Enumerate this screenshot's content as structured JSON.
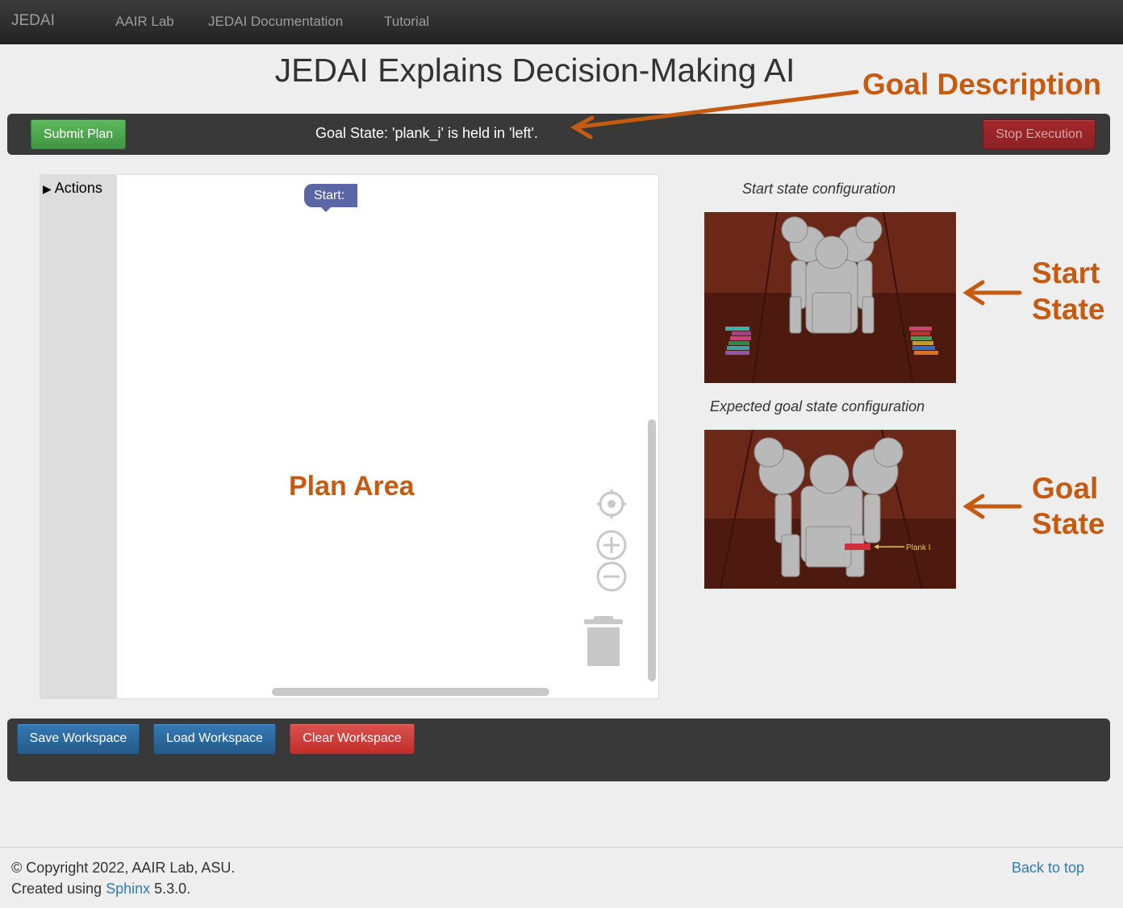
{
  "navbar": {
    "brand": "JEDAI",
    "links": [
      "AAIR Lab",
      "JEDAI Documentation",
      "Tutorial"
    ]
  },
  "page_title": "JEDAI Explains Decision-Making AI",
  "goal_bar": {
    "submit_label": "Submit Plan",
    "goal_text": "Goal State: 'plank_i' is held in 'left'.",
    "stop_label": "Stop Execution"
  },
  "workspace": {
    "category": "Actions",
    "start_block": "Start:"
  },
  "start_state": {
    "caption": "Start state configuration"
  },
  "goal_state": {
    "caption": "Expected goal state configuration",
    "plank_label": "Plank I"
  },
  "annotations": {
    "goal_description": "Goal Description",
    "plan_area": "Plan Area",
    "start_state_line1": "Start",
    "start_state_line2": "State",
    "goal_state_line1": "Goal",
    "goal_state_line2": "State",
    "color": "#c55a11"
  },
  "bottom_bar": {
    "save_label": "Save Workspace",
    "load_label": "Load Workspace",
    "clear_label": "Clear Workspace"
  },
  "footer": {
    "copyright": "© Copyright 2022, AAIR Lab, ASU.",
    "created_prefix": "Created using",
    "sphinx_link": "Sphinx",
    "sphinx_version": "5.3.0.",
    "back_to_top": "Back to top"
  }
}
